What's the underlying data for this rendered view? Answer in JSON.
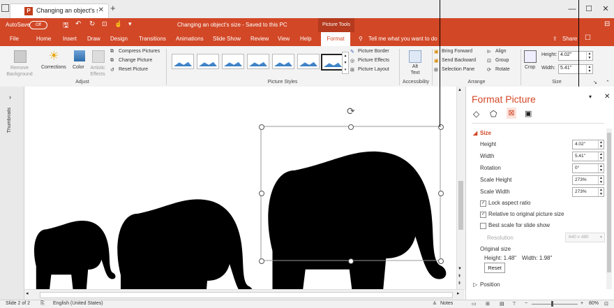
{
  "browser": {
    "tab_title": "Changing an object's si",
    "window_controls": [
      "—",
      "☐",
      "✕"
    ]
  },
  "titlebar": {
    "autosave": "AutoSave",
    "autosave_state": "Off",
    "doc_title": "Changing an object's size - Saved to this PC",
    "tool_context": "Picture Tools"
  },
  "menu": {
    "items": [
      "File",
      "Home",
      "Insert",
      "Draw",
      "Design",
      "Transitions",
      "Animations",
      "Slide Show",
      "Review",
      "View",
      "Help"
    ],
    "active_tab": "Format",
    "tell_me": "Tell me what you want to do",
    "share": "Share"
  },
  "ribbon": {
    "remove_background": "Remove Background",
    "corrections": "Corrections",
    "color": "Color",
    "artistic_effects": "Artistic Effects",
    "compress_pictures": "Compress Pictures",
    "change_picture": "Change Picture",
    "reset_picture": "Reset Picture",
    "adjust_group": "Adjust",
    "picture_styles_group": "Picture Styles",
    "picture_border": "Picture Border",
    "picture_effects": "Picture Effects",
    "picture_layout": "Picture Layout",
    "alt_text": "Alt Text",
    "accessibility_group": "Accessibility",
    "bring_forward": "Bring Forward",
    "send_backward": "Send Backward",
    "selection_pane": "Selection Pane",
    "align": "Align",
    "group": "Group",
    "rotate": "Rotate",
    "arrange_group": "Arrange",
    "crop": "Crop",
    "height_label": "Height:",
    "height_value": "4.02\"",
    "width_label": "Width:",
    "width_value": "5.41\"",
    "size_group": "Size"
  },
  "sidebar": {
    "thumbnails_label": "Thumbnails"
  },
  "format_pane": {
    "title": "Format Picture",
    "size_section": "Size",
    "height_label": "Height",
    "height_value": "4.02\"",
    "width_label": "Width",
    "width_value": "5.41\"",
    "rotation_label": "Rotation",
    "rotation_value": "0°",
    "scale_height_label": "Scale Height",
    "scale_height_value": "273%",
    "scale_width_label": "Scale Width",
    "scale_width_value": "273%",
    "lock_aspect_ratio": "Lock aspect ratio",
    "relative_original": "Relative to original picture size",
    "best_scale": "Best scale for slide show",
    "resolution_label": "Resolution",
    "resolution_value": "640 x 480",
    "original_size_label": "Original size",
    "original_height": "Height:  1.48\"",
    "original_width": "Width:  1.98\"",
    "reset_button": "Reset",
    "position_section": "Position"
  },
  "status": {
    "slide_info": "Slide 2 of 2",
    "language": "English (United States)",
    "notes": "Notes",
    "zoom": "80%"
  }
}
